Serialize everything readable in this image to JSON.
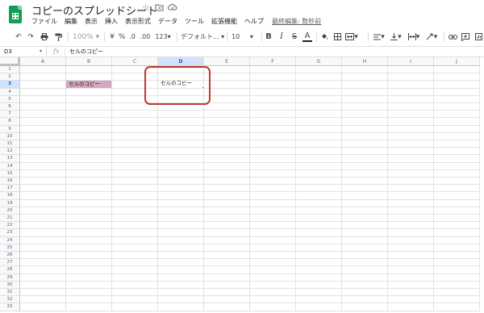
{
  "app": {
    "doc_title": "コピーのスプレッドシート",
    "title_icons": [
      "star-icon",
      "move-folder-icon",
      "cloud-status-icon"
    ]
  },
  "menu": {
    "items": [
      "ファイル",
      "編集",
      "表示",
      "挿入",
      "表示形式",
      "データ",
      "ツール",
      "拡張機能",
      "ヘルプ"
    ],
    "last_edit": "最終編集: 数秒前"
  },
  "toolbar": {
    "zoom": "100%",
    "currency": "¥",
    "percent": "%",
    "decimal_decrease": ".0",
    "decimal_increase": ".00",
    "more_formats": "123",
    "font": "デフォルト...",
    "font_size": "10",
    "bold": "B",
    "italic": "I",
    "strike": "S",
    "text_color": "A"
  },
  "formula_bar": {
    "name_box": "D3",
    "fx": "fx",
    "content": "セルのコピー"
  },
  "grid": {
    "columns": [
      "A",
      "B",
      "C",
      "D",
      "E",
      "F",
      "G",
      "H",
      "I",
      "J"
    ],
    "rows": [
      "1",
      "2",
      "3",
      "4",
      "5",
      "6",
      "7",
      "8",
      "9",
      "10",
      "11",
      "12",
      "13",
      "14",
      "15",
      "16",
      "17",
      "18",
      "19",
      "20",
      "21",
      "22",
      "23",
      "24",
      "25",
      "26",
      "27",
      "28",
      "29",
      "30",
      "31",
      "32",
      "33"
    ],
    "active_column": "D",
    "active_row": "3",
    "cells": {
      "B3": {
        "value": "セルのコピー",
        "fill": "#d5a6bd"
      },
      "D3": {
        "value": "セルのコピー",
        "fill": "#ffffff"
      }
    }
  },
  "annotation": {
    "highlight_color": "#c0392b",
    "selection_color": "#1a73e8"
  }
}
